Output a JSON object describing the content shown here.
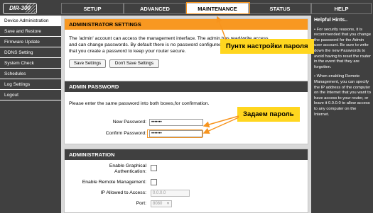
{
  "header": {
    "model": "DIR-300",
    "tabs": [
      {
        "label": "SETUP"
      },
      {
        "label": "ADVANCED"
      },
      {
        "label": "MAINTENANCE"
      },
      {
        "label": "STATUS"
      },
      {
        "label": "HELP"
      }
    ],
    "active_tab": "MAINTENANCE"
  },
  "sidebar": {
    "items": [
      {
        "label": "Device Administration"
      },
      {
        "label": "Save and Restore"
      },
      {
        "label": "Firmware Update"
      },
      {
        "label": "DDNS Setting"
      },
      {
        "label": "System Check"
      },
      {
        "label": "Schedules"
      },
      {
        "label": "Log Settings"
      },
      {
        "label": "Logout"
      }
    ],
    "active": "Device Administration"
  },
  "admin_settings": {
    "title": "ADMINISTRATOR SETTINGS",
    "line1": "The 'admin' account can access the management interface. The admin has read/write access",
    "line2": "and can change passwords. By default there is no password configured. It is highly recommended",
    "line3": "that you create a password to keep your router secure.",
    "save_label": "Save Settings",
    "dont_save_label": "Don't Save Settings"
  },
  "admin_password": {
    "title": "ADMIN PASSWORD",
    "instruction": "Please enter the same password into both boxes,for confirmation.",
    "new_password_label": "New Password:",
    "new_password_value": "•••••••",
    "confirm_password_label": "Confirm Password:",
    "confirm_password_value": "•••••••"
  },
  "administration": {
    "title": "ADMINISTRATION",
    "graphical_auth_label_1": "Enable Graphical",
    "graphical_auth_label_2": "Authentication:",
    "remote_mgmt_label": "Enable Remote Management:",
    "ip_allowed_label": "IP Allowed to Access:",
    "ip_allowed_value": "0.0.0.0",
    "port_label": "Port:",
    "port_value": "8080"
  },
  "help": {
    "title": "Helpful Hints..",
    "tip1": "• For security reasons, it is recommended that you change the password for the Admin user account. Be sure to write down the new Passwords to avoid having to reset the router in the event that they are forgotten.",
    "tip2": "• When enabling Remote Management, you can specify the IP address of the computer on the Internet that you want to have access to your router, or leave it 0.0.0.0 to allow access to any computer on the Internet."
  },
  "annotations": {
    "callout_password_settings": "Пунтк настройки пароля",
    "callout_set_password": "Задаем пароль",
    "highlight_color": "#f7941d",
    "callout_color": "#ffd61f"
  }
}
